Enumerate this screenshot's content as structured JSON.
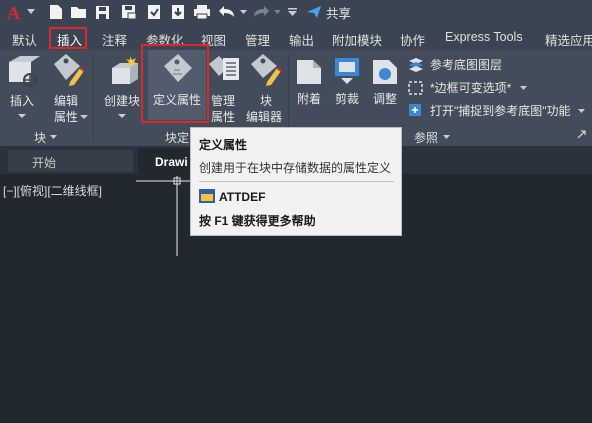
{
  "quick_access": {
    "share_label": "共享"
  },
  "menu_tabs": [
    {
      "label": "默认"
    },
    {
      "label": "插入"
    },
    {
      "label": "注释"
    },
    {
      "label": "参数化"
    },
    {
      "label": "视图"
    },
    {
      "label": "管理"
    },
    {
      "label": "输出"
    },
    {
      "label": "附加模块"
    },
    {
      "label": "协作"
    },
    {
      "label": "Express Tools"
    },
    {
      "label": "精选应用"
    }
  ],
  "ribbon": {
    "block_panel": {
      "title": "块",
      "insert_label": "插入",
      "edit_attr_label_1": "编辑",
      "edit_attr_label_2": "属性"
    },
    "block_def_panel": {
      "title": "块定",
      "create_label": "创建块",
      "define_attr_label": "定义属性",
      "manage_attr_label_1": "管理",
      "manage_attr_label_2": "属性",
      "block_editor_label_1": "块",
      "block_editor_label_2": "编辑器"
    },
    "reference_panel": {
      "title": "参照",
      "attach_label": "附着",
      "clip_label": "剪裁",
      "adjust_label": "调整",
      "underlay_layers_label": "参考底图图层",
      "frame_label": "*边框可变选项*",
      "snap_label": "打开\"捕捉到参考底图\"功能"
    }
  },
  "file_tabs": [
    {
      "label": "开始"
    },
    {
      "label": "Drawi"
    }
  ],
  "viewport": {
    "label": "[−][俯视][二维线框]"
  },
  "tooltip": {
    "title": "定义属性",
    "description": "创建用于在块中存储数据的属性定义",
    "command": "ATTDEF",
    "help": "按 F1 键获得更多帮助"
  },
  "colors": {
    "highlight": "#e0262b",
    "background": "#212830",
    "ribbon": "#434c5a"
  }
}
